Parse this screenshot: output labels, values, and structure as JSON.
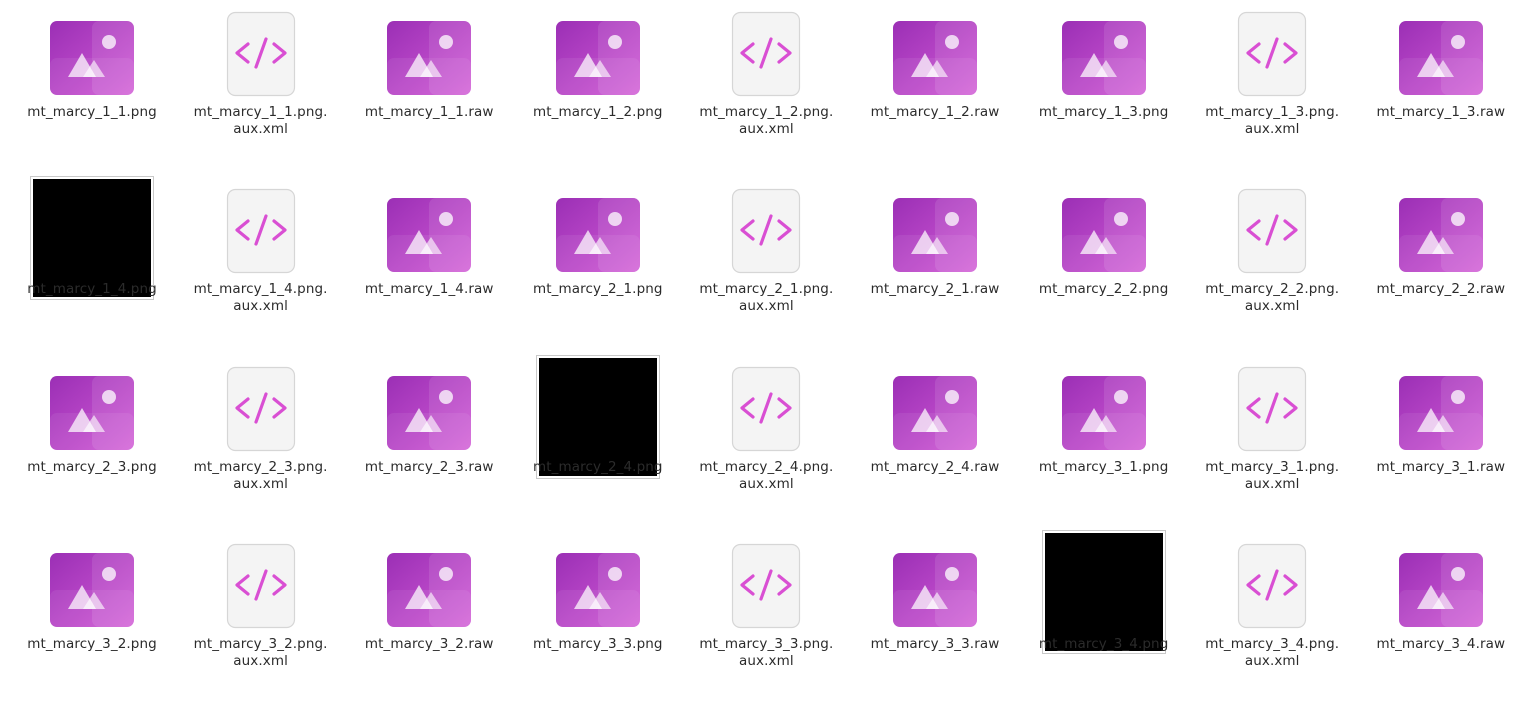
{
  "colors": {
    "image_icon_dark": "#9b2fb5",
    "image_icon_light": "#d15ad6",
    "xml_icon_glyph": "#d94fd3",
    "xml_icon_bg": "#f4f4f4",
    "thumbnail": "#000000"
  },
  "files": [
    {
      "label": "mt_marcy_1_1.png",
      "type": "image-icon"
    },
    {
      "label": "mt_marcy_1_1.png.\naux.xml",
      "type": "xml-icon"
    },
    {
      "label": "mt_marcy_1_1.raw",
      "type": "image-icon"
    },
    {
      "label": "mt_marcy_1_2.png",
      "type": "image-icon"
    },
    {
      "label": "mt_marcy_1_2.png.\naux.xml",
      "type": "xml-icon"
    },
    {
      "label": "mt_marcy_1_2.raw",
      "type": "image-icon"
    },
    {
      "label": "mt_marcy_1_3.png",
      "type": "image-icon"
    },
    {
      "label": "mt_marcy_1_3.png.\naux.xml",
      "type": "xml-icon"
    },
    {
      "label": "mt_marcy_1_3.raw",
      "type": "image-icon"
    },
    {
      "label": "mt_marcy_1_4.png",
      "type": "thumbnail"
    },
    {
      "label": "mt_marcy_1_4.png.\naux.xml",
      "type": "xml-icon"
    },
    {
      "label": "mt_marcy_1_4.raw",
      "type": "image-icon"
    },
    {
      "label": "mt_marcy_2_1.png",
      "type": "image-icon"
    },
    {
      "label": "mt_marcy_2_1.png.\naux.xml",
      "type": "xml-icon"
    },
    {
      "label": "mt_marcy_2_1.raw",
      "type": "image-icon"
    },
    {
      "label": "mt_marcy_2_2.png",
      "type": "image-icon"
    },
    {
      "label": "mt_marcy_2_2.png.\naux.xml",
      "type": "xml-icon"
    },
    {
      "label": "mt_marcy_2_2.raw",
      "type": "image-icon"
    },
    {
      "label": "mt_marcy_2_3.png",
      "type": "image-icon"
    },
    {
      "label": "mt_marcy_2_3.png.\naux.xml",
      "type": "xml-icon"
    },
    {
      "label": "mt_marcy_2_3.raw",
      "type": "image-icon"
    },
    {
      "label": "mt_marcy_2_4.png",
      "type": "thumbnail"
    },
    {
      "label": "mt_marcy_2_4.png.\naux.xml",
      "type": "xml-icon"
    },
    {
      "label": "mt_marcy_2_4.raw",
      "type": "image-icon"
    },
    {
      "label": "mt_marcy_3_1.png",
      "type": "image-icon"
    },
    {
      "label": "mt_marcy_3_1.png.\naux.xml",
      "type": "xml-icon"
    },
    {
      "label": "mt_marcy_3_1.raw",
      "type": "image-icon"
    },
    {
      "label": "mt_marcy_3_2.png",
      "type": "image-icon"
    },
    {
      "label": "mt_marcy_3_2.png.\naux.xml",
      "type": "xml-icon"
    },
    {
      "label": "mt_marcy_3_2.raw",
      "type": "image-icon"
    },
    {
      "label": "mt_marcy_3_3.png",
      "type": "image-icon"
    },
    {
      "label": "mt_marcy_3_3.png.\naux.xml",
      "type": "xml-icon"
    },
    {
      "label": "mt_marcy_3_3.raw",
      "type": "image-icon"
    },
    {
      "label": "mt_marcy_3_4.png",
      "type": "thumbnail"
    },
    {
      "label": "mt_marcy_3_4.png.\naux.xml",
      "type": "xml-icon"
    },
    {
      "label": "mt_marcy_3_4.raw",
      "type": "image-icon"
    }
  ]
}
